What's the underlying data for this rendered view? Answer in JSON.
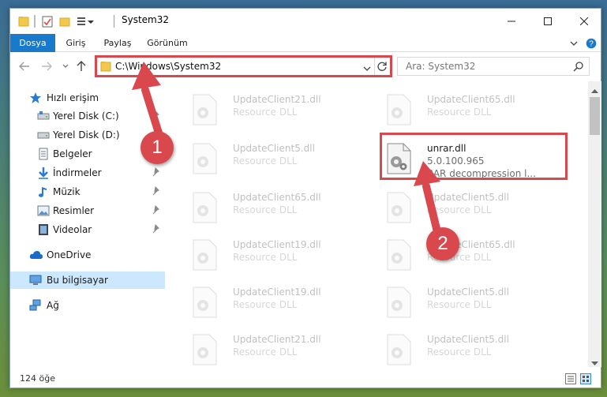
{
  "window": {
    "title": "System32"
  },
  "ribbon": {
    "tabs": [
      "Dosya",
      "Giriş",
      "Paylaş",
      "Görünüm"
    ]
  },
  "address": {
    "path": "C:\\Windows\\System32"
  },
  "search": {
    "placeholder": "Ara: System32"
  },
  "sidebar": {
    "items": [
      {
        "label": "Hızlı erişim",
        "icon": "star-icon"
      },
      {
        "label": "Yerel Disk (C:)",
        "icon": "drive-icon",
        "pinned": true
      },
      {
        "label": "Yerel Disk (D:)",
        "icon": "drive-icon",
        "pinned": true
      },
      {
        "label": "Belgeler",
        "icon": "documents-icon",
        "pinned": true
      },
      {
        "label": "İndirmeler",
        "icon": "downloads-icon",
        "pinned": true
      },
      {
        "label": "Müzik",
        "icon": "music-icon",
        "pinned": true
      },
      {
        "label": "Resimler",
        "icon": "pictures-icon",
        "pinned": true
      },
      {
        "label": "Videolar",
        "icon": "videos-icon",
        "pinned": true
      },
      {
        "label": "OneDrive",
        "icon": "cloud-icon"
      },
      {
        "label": "Bu bilgisayar",
        "icon": "computer-icon",
        "selected": true
      },
      {
        "label": "Ağ",
        "icon": "network-icon"
      }
    ]
  },
  "files": [
    {
      "name": "UpdateClient21.dll",
      "desc": "Resource DLL"
    },
    {
      "name": "UpdateClient65.dll",
      "desc": "Resource DLL"
    },
    {
      "name": "UpdateClient5.dll",
      "desc": "Resource DLL"
    },
    {
      "name": "unrar.dll",
      "desc": "5.0.100.965",
      "desc2": "RAR decompression l...",
      "highlighted": true
    },
    {
      "name": "UpdateClient65.dll",
      "desc": "Resource DLL"
    },
    {
      "name": "UpdateClient5.dll",
      "desc": "Resource DLL"
    },
    {
      "name": "UpdateClient19.dll",
      "desc": "Resource DLL"
    },
    {
      "name": "UpdateClient65.dll",
      "desc": "Resource DLL"
    },
    {
      "name": "UpdateClient19.dll",
      "desc": "Resource DLL"
    },
    {
      "name": "UpdateClient5.dll",
      "desc": "Resource DLL"
    },
    {
      "name": "UpdateClient21.dll",
      "desc": "Resource DLL"
    },
    {
      "name": "UpdateClient5.dll",
      "desc": "Resource DLL"
    }
  ],
  "status": {
    "count": "124 öğe"
  },
  "callouts": {
    "one": "1",
    "two": "2"
  },
  "colors": {
    "accent": "#1979ca",
    "highlight": "#d8484d",
    "selected": "#cce8ff"
  }
}
